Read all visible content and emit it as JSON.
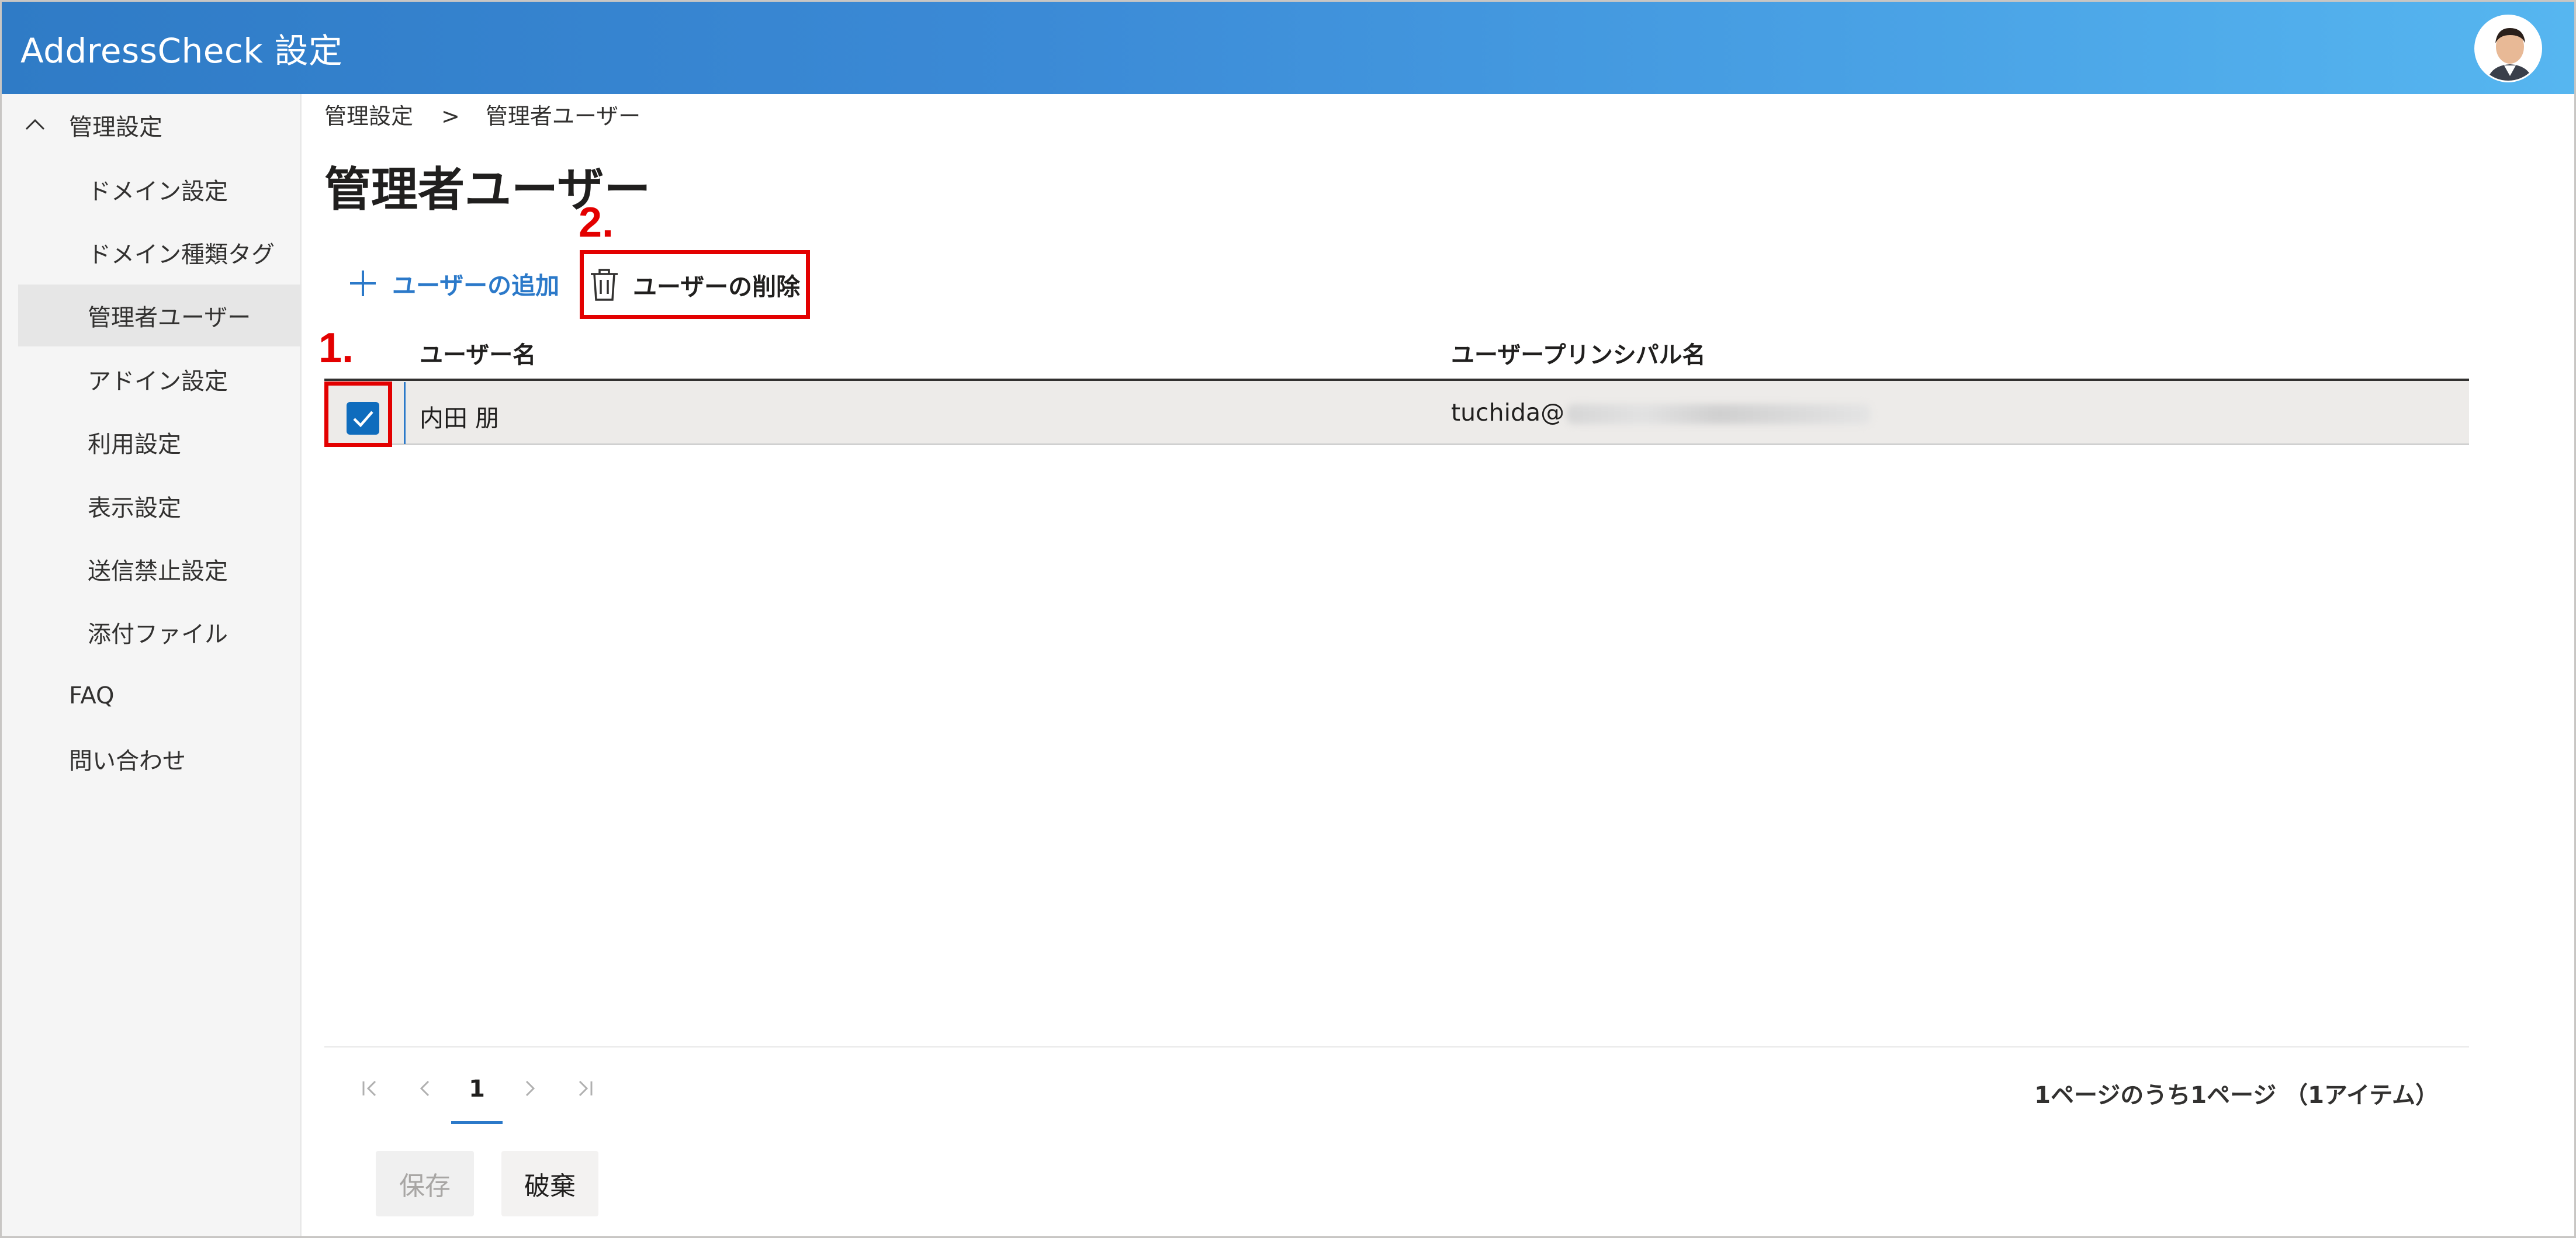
{
  "app": {
    "title": "AddressCheck 設定"
  },
  "sidebar": {
    "items": [
      {
        "label": "管理設定"
      },
      {
        "label": "ドメイン設定"
      },
      {
        "label": "ドメイン種類タグ"
      },
      {
        "label": "管理者ユーザー"
      },
      {
        "label": "アドイン設定"
      },
      {
        "label": "利用設定"
      },
      {
        "label": "表示設定"
      },
      {
        "label": "送信禁止設定"
      },
      {
        "label": "添付ファイル"
      },
      {
        "label": "FAQ"
      },
      {
        "label": "問い合わせ"
      }
    ]
  },
  "breadcrumb": {
    "root": "管理設定",
    "separator": ">",
    "current": "管理者ユーザー"
  },
  "page": {
    "title": "管理者ユーザー"
  },
  "annotations": {
    "step1": "1.",
    "step2": "2."
  },
  "commands": {
    "add_user": "ユーザーの追加",
    "delete_user": "ユーザーの削除"
  },
  "table": {
    "columns": {
      "name": "ユーザー名",
      "upn": "ユーザープリンシパル名"
    },
    "rows": [
      {
        "name": "内田 朋",
        "upn": "tuchida@"
      }
    ]
  },
  "pagination": {
    "current_page": "1",
    "summary": "1ページのうち1ページ （1アイテム）"
  },
  "buttons": {
    "save": "保存",
    "discard": "破棄"
  },
  "colors": {
    "accent": "#2b79c9",
    "annotation": "#e30000",
    "checkbox": "#0f6cbd"
  }
}
